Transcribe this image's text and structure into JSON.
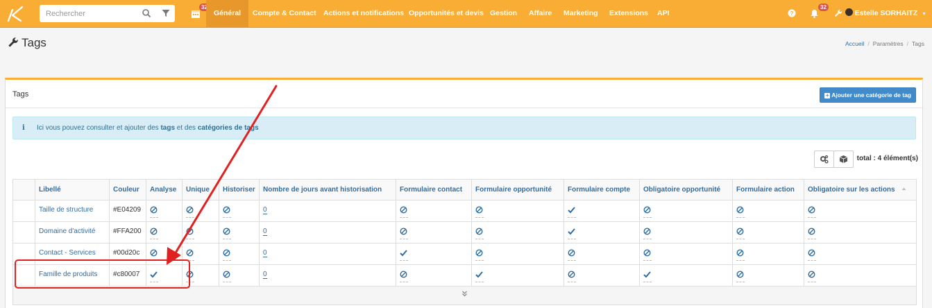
{
  "search": {
    "placeholder": "Rechercher"
  },
  "topbar": {
    "calendar_badge": "32",
    "notif_badge": "32",
    "menu": [
      "Général",
      "Compte & Contact",
      "Actions et notifications",
      "Opportunités et devis",
      "Gestion",
      "Affaire",
      "Marketing",
      "Extensions",
      "API"
    ],
    "user_name": "Estelle SORHAITZ"
  },
  "page": {
    "title": "Tags"
  },
  "breadcrumb": [
    "Accueil",
    "Paramètres",
    "Tags"
  ],
  "panel": {
    "title": "Tags",
    "add_button": "Ajouter une catégorie de tag",
    "info_prefix": "Ici vous pouvez consulter et ajouter des ",
    "info_tags": "tags",
    "info_mid": " et des ",
    "info_categories": "catégories de tags",
    "total": "total : 4 élément(s)"
  },
  "table": {
    "headers": [
      "Libellé",
      "Couleur",
      "Analyse",
      "Unique",
      "Historiser",
      "Nombre de jours avant historisation",
      "Formulaire contact",
      "Formulaire opportunité",
      "Formulaire compte",
      "Obligatoire opportunité",
      "Formulaire action",
      "Obligatoire sur les actions"
    ],
    "rows": [
      {
        "libelle": "Taille de structure",
        "couleur": "#E04209",
        "analyse": "no",
        "unique": "no",
        "historiser": "no",
        "jours": "0",
        "f_contact": "no",
        "f_opp": "no",
        "f_compte": "yes",
        "o_opp": "no",
        "f_action": "no",
        "o_action": "no"
      },
      {
        "libelle": "Domaine d'activité",
        "couleur": "#FFA200",
        "analyse": "no",
        "unique": "no",
        "historiser": "no",
        "jours": "0",
        "f_contact": "no",
        "f_opp": "no",
        "f_compte": "yes",
        "o_opp": "no",
        "f_action": "no",
        "o_action": "no"
      },
      {
        "libelle": "Contact - Services",
        "couleur": "#00d20c",
        "analyse": "no",
        "unique": "no",
        "historiser": "no",
        "jours": "0",
        "f_contact": "yes",
        "f_opp": "no",
        "f_compte": "no",
        "o_opp": "no",
        "f_action": "no",
        "o_action": "no"
      },
      {
        "libelle": "Famille de produits",
        "couleur": "#c80007",
        "analyse": "yes",
        "unique": "no",
        "historiser": "no",
        "jours": "0",
        "f_contact": "no",
        "f_opp": "yes",
        "f_compte": "no",
        "o_opp": "yes",
        "f_action": "no",
        "o_action": "no"
      }
    ]
  },
  "colors": {
    "accent": "#f9ad35",
    "link": "#2e6da4",
    "annotation": "#e0211f"
  }
}
